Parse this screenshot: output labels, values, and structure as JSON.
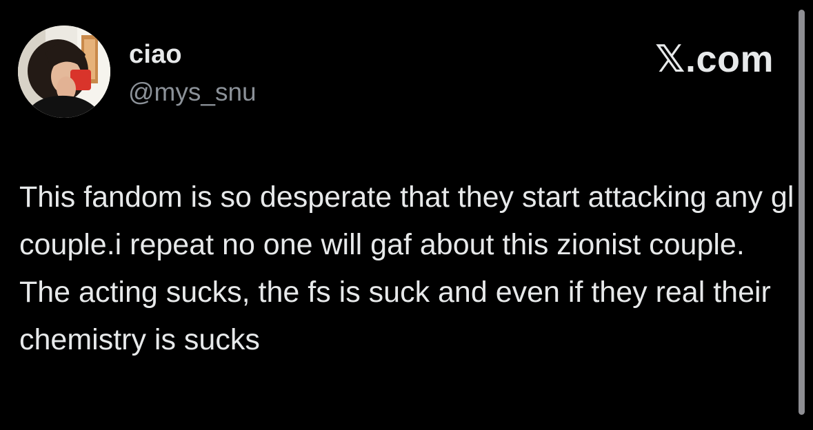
{
  "brand": {
    "label": "𝕏.com"
  },
  "author": {
    "display_name": "ciao",
    "handle": "@mys_snu",
    "avatar_icon": "avatar-photo"
  },
  "tweet": {
    "text": "This fandom is so desperate that they start attacking any gl couple.i repeat no one will gaf about this zionist couple. The acting sucks, the fs is suck and even if they real their chemistry is sucks"
  },
  "colors": {
    "background": "#000000",
    "primary_text": "#e7e9ea",
    "secondary_text": "#8b9198"
  }
}
